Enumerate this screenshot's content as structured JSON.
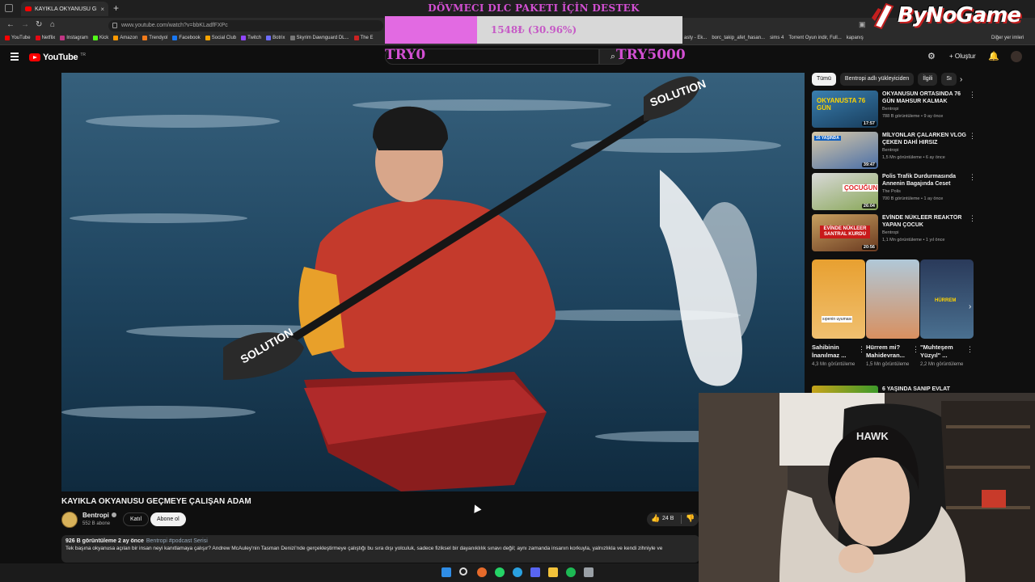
{
  "browser": {
    "tab_title": "KAYIKLA OKYANUSU GEÇM",
    "tab_close": "×",
    "tab_new": "+",
    "url": "www.youtube.com/watch?v=bbKLadfFXPc",
    "bookmarks": [
      {
        "label": "YouTube",
        "color": "#ff0000"
      },
      {
        "label": "Netflix",
        "color": "#e50914"
      },
      {
        "label": "Instagram",
        "color": "#c13584"
      },
      {
        "label": "Kick",
        "color": "#53fc18"
      },
      {
        "label": "Amazon",
        "color": "#ff9900"
      },
      {
        "label": "Trendyol",
        "color": "#f27a1a"
      },
      {
        "label": "Facebook",
        "color": "#1877f2"
      },
      {
        "label": "Social Club",
        "color": "#f5a300"
      },
      {
        "label": "Twitch",
        "color": "#9146ff"
      },
      {
        "label": "Botrix",
        "color": "#6c6cff"
      },
      {
        "label": "Skyrim Dawnguard DL...",
        "color": "#777777"
      },
      {
        "label": "The E",
        "color": "#cc2222"
      }
    ],
    "bookmarks_right": [
      "asty - Ek...",
      "borc_takip_afet_hasan...",
      "sims 4",
      "Torrent Oyun indir, Full...",
      "kapanış"
    ],
    "bookmarks_other": "Diğer yer imleri"
  },
  "donation": {
    "title": "DÖVMECI DLC PAKETI İÇİN DESTEK",
    "progress_text": "1548₺ (30.96%)",
    "progress_fraction": 0.3096,
    "min_label": "TRY0",
    "max_label": "TRY5000",
    "color": "#d24fd2"
  },
  "brand": {
    "text": "ByNoGame"
  },
  "youtube": {
    "logo_text": "YouTube",
    "logo_region": "TR",
    "create_label": "Oluştur",
    "video": {
      "title": "KAYIKLA OKYANUSU GEÇMEYE ÇALIŞAN ADAM",
      "channel": "Bentropi",
      "subscribers": "552 B abone",
      "join_label": "Katıl",
      "subscribe_label": "Abone ol",
      "likes": "24 B",
      "stats": "926 B görüntüleme  2 ay önce",
      "tags": "Bentropi  #podcast Serisi",
      "description": "Tek başına okyanusa açılan bir insan neyi kanıtlamaya çalışır? Andrew McAuley'nin Tasman Denizi'nde gerçekleştirmeye çalıştığı bu sıra dışı yolculuk, sadece fiziksel bir dayanıklılık sınavı değil; aynı zamanda insanın korkuyla, yalnızlıkla ve kendi zihniyle ve"
    },
    "chips": [
      "Tümü",
      "Bentropi adlı yükleyiciden",
      "İlgili",
      "Sı"
    ],
    "recommendations": [
      {
        "title": "OKYANUSUN ORTASINDA 76 GÜN MAHSUR KALMAK",
        "channel": "Bentropi",
        "meta": "788 B görüntüleme • 9 ay önce",
        "duration": "17:57",
        "thumb_text": "OKYANUSTA 76 GÜN"
      },
      {
        "title": "MİLYONLAR ÇALARKEN VLOG ÇEKEN DAHİ HIRSIZ",
        "channel": "Bentropi",
        "meta": "1,5 Mn görüntüleme • 6 ay önce",
        "duration": "39:47",
        "thumb_text": "16 YAŞINDA"
      },
      {
        "title": "Polis Trafik Durdurmasında Annenin Bagajında Ceset Buldu",
        "channel": "The Polis",
        "meta": "700 B görüntüleme • 1 ay önce",
        "duration": "26:04",
        "thumb_text": "ÇOCUĞUN"
      },
      {
        "title": "EVİNDE NÜKLEER REAKTÖR YAPAN ÇOCUK",
        "channel": "Bentropi",
        "meta": "1,1 Mn görüntüleme • 1 yıl önce",
        "duration": "20:56",
        "thumb_text": "EVİNDE NÜKLEER SANTRAL KURDU"
      }
    ],
    "shorts": [
      {
        "title": "Sahibinin İnanılmaz ...",
        "views": "4,3 Mn görüntüleme",
        "thumb_text": "sıpenin uyuması"
      },
      {
        "title": "Hürrem mi? Mahidevran...",
        "views": "1,5 Mn görüntüleme",
        "thumb_text": ""
      },
      {
        "title": "\"Muhteşem Yüzyıl\" ...",
        "views": "2,2 Mn görüntüleme",
        "thumb_text": "HÜRREM"
      }
    ],
    "last_rec_title": "6 YAŞINDA SANIP EVLAT"
  },
  "webcam": {
    "chair_text": "HAWK"
  },
  "taskbar": {
    "icons": [
      "windows-icon",
      "search-icon",
      "firefox-icon",
      "whatsapp-icon",
      "telegram-icon",
      "discord-icon",
      "folder-icon",
      "spotify-icon",
      "calculator-icon"
    ]
  }
}
